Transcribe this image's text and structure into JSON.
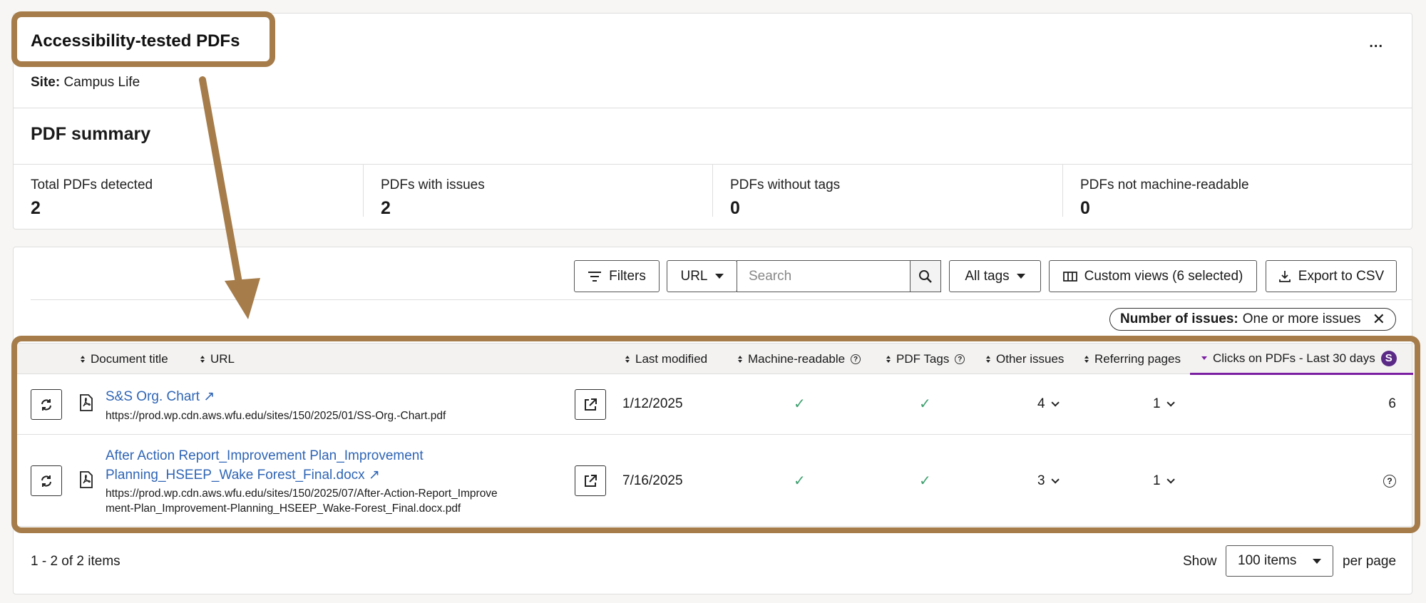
{
  "header": {
    "title": "Accessibility-tested PDFs",
    "more_label": "...",
    "site_label": "Site:",
    "site_value": "Campus Life"
  },
  "summary": {
    "title": "PDF summary",
    "stats": [
      {
        "label": "Total PDFs detected",
        "value": "2"
      },
      {
        "label": "PDFs with issues",
        "value": "2"
      },
      {
        "label": "PDFs without tags",
        "value": "0"
      },
      {
        "label": "PDFs not machine-readable",
        "value": "0"
      }
    ]
  },
  "toolbar": {
    "filters_label": "Filters",
    "url_select": "URL",
    "search_placeholder": "Search",
    "tags_select": "All tags",
    "custom_views_label": "Custom views (6 selected)",
    "export_label": "Export to CSV"
  },
  "active_filter": {
    "label": "Number of issues:",
    "value": "One or more issues"
  },
  "table": {
    "columns": {
      "document_title": "Document title",
      "url": "URL",
      "last_modified": "Last modified",
      "machine_readable": "Machine-readable",
      "pdf_tags": "PDF Tags",
      "other_issues": "Other issues",
      "referring_pages": "Referring pages",
      "clicks": "Clicks on PDFs - Last 30 days",
      "clicks_badge": "S"
    },
    "rows": [
      {
        "title": "S&S Org. Chart ↗",
        "url": "https://prod.wp.cdn.aws.wfu.edu/sites/150/2025/01/SS-Org.-Chart.pdf",
        "last_modified": "1/12/2025",
        "other_issues": "4",
        "referring_pages": "1",
        "clicks": "6"
      },
      {
        "title_line1": "After Action Report_Improvement Plan_Improvement",
        "title_line2": "Planning_HSEEP_Wake Forest_Final.docx ↗",
        "url_line1": "https://prod.wp.cdn.aws.wfu.edu/sites/150/2025/07/After-Action-Report_Improve",
        "url_line2": "ment-Plan_Improvement-Planning_HSEEP_Wake-Forest_Final.docx.pdf",
        "last_modified": "7/16/2025",
        "other_issues": "3",
        "referring_pages": "1",
        "clicks": "?"
      }
    ]
  },
  "footer": {
    "count": "1 - 2 of 2 items",
    "show_label": "Show",
    "page_size": "100 items",
    "per_page_label": "per page"
  },
  "colors": {
    "annotation": "#a57c4a",
    "link": "#2f65b5",
    "check": "#3fa06f",
    "active_sort": "#7b1fa2"
  }
}
